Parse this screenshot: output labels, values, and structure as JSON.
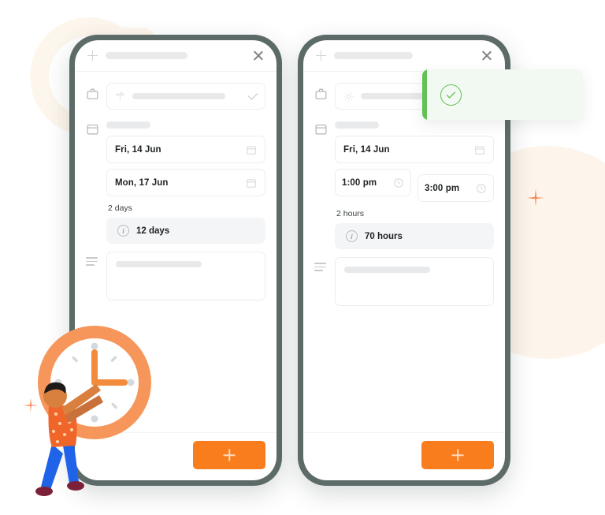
{
  "theme": {
    "accent_orange": "#f97d1c",
    "phone_frame": "#5c6b68",
    "success_green": "#63c054",
    "toast_bg": "#f2f9f2",
    "cream": "#fdf6ec",
    "pill_bg": "#f4f5f7"
  },
  "panels": [
    {
      "id": "left",
      "header": {
        "add_icon": "plus-icon",
        "title_placeholder": "",
        "close_icon": "close-icon"
      },
      "leave_type": {
        "lead_icon": "briefcase-icon",
        "inner_icon": "palm-tree-icon",
        "value": "",
        "chevron_icon": "chevron-down-icon"
      },
      "dates": {
        "lead_icon": "calendar-icon",
        "label": "",
        "fields": [
          {
            "value": "Fri, 14 Jun",
            "icon": "calendar-icon"
          },
          {
            "value": "Mon, 17 Jun",
            "icon": "calendar-icon"
          }
        ]
      },
      "duration_note": "2 days",
      "balance_pill": {
        "icon": "info-icon",
        "text": "12 days"
      },
      "notes": {
        "lead_icon": "notes-icon",
        "value": ""
      },
      "footer": {
        "submit_icon": "plus-icon",
        "submit_label": ""
      }
    },
    {
      "id": "right",
      "header": {
        "add_icon": "plus-icon",
        "title_placeholder": "",
        "close_icon": "close-icon"
      },
      "leave_type": {
        "lead_icon": "briefcase-icon",
        "inner_icon": "sun-icon",
        "value": "",
        "chevron_icon": "chevron-down-icon"
      },
      "dates": {
        "lead_icon": "calendar-icon",
        "label": "",
        "fields": [
          {
            "value": "Fri, 14 Jun",
            "icon": "calendar-icon"
          }
        ],
        "times": [
          {
            "value": "1:00 pm",
            "icon": "clock-icon"
          },
          {
            "value": "3:00 pm",
            "icon": "clock-icon"
          }
        ]
      },
      "duration_note": "2 hours",
      "balance_pill": {
        "icon": "info-icon",
        "text": "70 hours"
      },
      "notes": {
        "lead_icon": "notes-icon",
        "value": ""
      },
      "footer": {
        "submit_icon": "plus-icon",
        "submit_label": ""
      }
    }
  ],
  "toast": {
    "status": "success",
    "icon": "check-circle-icon",
    "message": ""
  },
  "decorations": {
    "ring": "cream-ring",
    "right_circle": "cream-circle",
    "sparkle_left": "sparkle-icon",
    "sparkle_right": "sparkle-icon",
    "illustration": "person-pushing-clock-illustration"
  }
}
